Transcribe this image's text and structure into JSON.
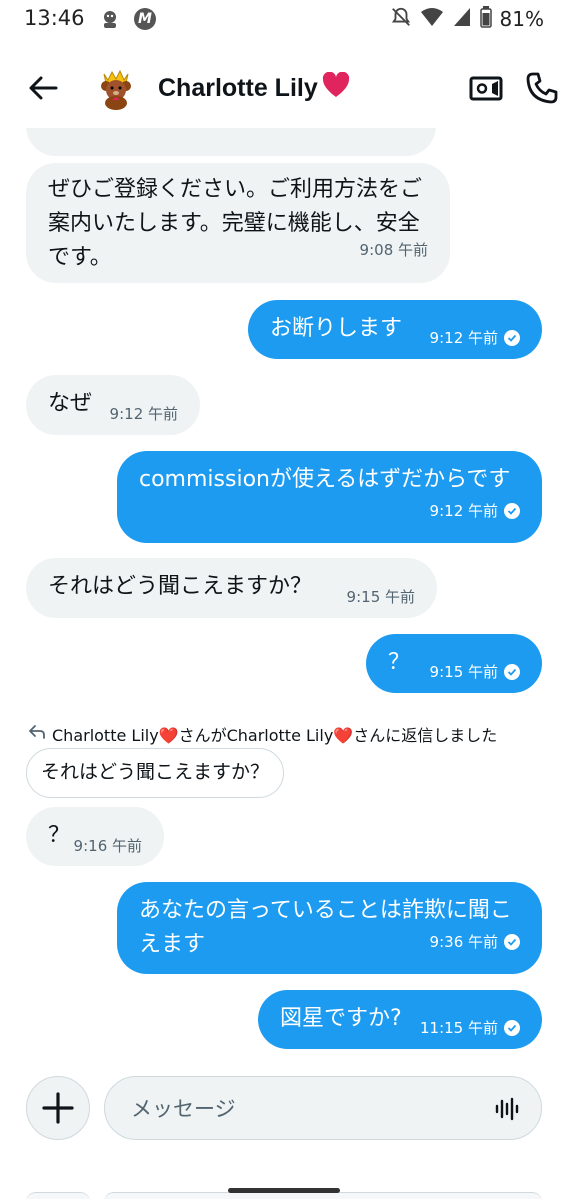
{
  "status_bar": {
    "time": "13:46",
    "battery": "81%"
  },
  "header": {
    "title": "Charlotte Lily",
    "title_emoji": "❤️"
  },
  "messages": [
    {
      "side": "recv",
      "text": "",
      "time": ""
    },
    {
      "side": "recv",
      "text": "ぜひご登録ください。ご利用方法をご案内いたします。完璧に機能し、安全です。",
      "time": "9:08 午前"
    },
    {
      "side": "sent",
      "text": "お断りします",
      "time": "9:12 午前"
    },
    {
      "side": "recv",
      "text": "なぜ",
      "time": "9:12 午前"
    },
    {
      "side": "sent",
      "text": "commissionが使えるはずだからです",
      "time": "9:12 午前"
    },
    {
      "side": "recv",
      "text": "それはどう聞こえますか？",
      "time": "9:15 午前"
    },
    {
      "side": "sent",
      "text": "？",
      "time": "9:15 午前"
    },
    {
      "side": "recv",
      "text": "？",
      "time": "9:16 午前"
    },
    {
      "side": "sent",
      "text": "あなたの言っていることは詐欺に聞こえます",
      "time": "9:36 午前"
    },
    {
      "side": "sent",
      "text": "図星ですか?",
      "time": "11:15 午前"
    }
  ],
  "reply_context": {
    "note": "Charlotte Lily❤️さんがCharlotte Lily❤️さんに返信しました",
    "quoted_text": "それはどう聞こえますか？"
  },
  "composer": {
    "placeholder": "メッセージ"
  },
  "colors": {
    "sent_bubble": "#1d9bf0",
    "recv_bubble": "#eff3f4",
    "text_primary": "#0f1419",
    "text_secondary": "#536471"
  },
  "icons": [
    "back-arrow-icon",
    "video-call-icon",
    "phone-icon",
    "plus-icon",
    "voice-wave-icon",
    "reply-arrow-icon",
    "read-check-icon"
  ]
}
